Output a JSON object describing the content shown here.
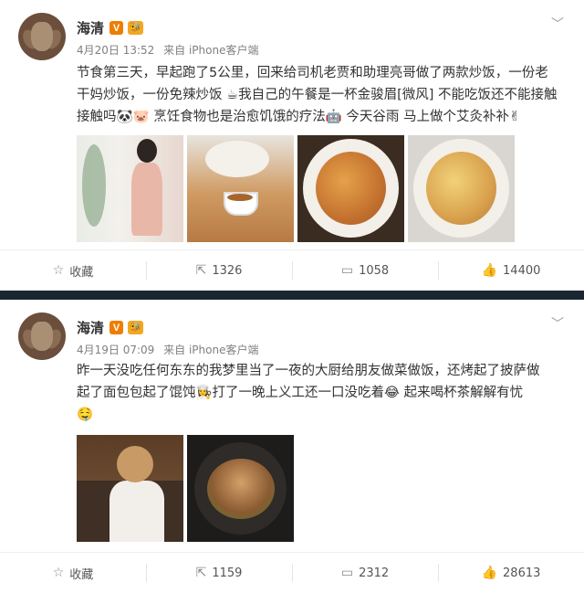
{
  "posts": [
    {
      "author": "海清",
      "verified_badge": "V",
      "vip_badge": "🐝",
      "date": "4月20日 13:52",
      "source": "来自 iPhone客户端",
      "text_lines": [
        "节食第三天，早起跑了5公里，回来给司机老贾和助理亮哥做了两款炒饭，一份老",
        "干妈炒饭，一份免辣炒饭 ☕我自己的午餐是一杯金骏眉[微风] 不能吃饭还不能接触",
        "接触吗🐼🐷 烹饪食物也是治愈饥饿的疗法🤖 今天谷雨 马上做个艾灸补补✌"
      ],
      "photos": [
        "woman-in-pink-dress-photo",
        "tea-cup-photo",
        "spicy-fried-rice-photo",
        "mild-fried-rice-photo"
      ],
      "actions": {
        "favorite": "收藏",
        "repost": "1326",
        "comment": "1058",
        "like": "14400"
      }
    },
    {
      "author": "海清",
      "verified_badge": "V",
      "vip_badge": "🐝",
      "date": "4月19日 07:09",
      "source": "来自 iPhone客户端",
      "text_lines": [
        "昨一天没吃任何东东的我梦里当了一夜的大厨给朋友做菜做饭，还烤起了披萨做",
        "起了面包包起了馄饨👩‍🍳打了一晚上义工还一口没吃着😂 起来喝杯茶解解有忧",
        "🤤"
      ],
      "photos": [
        "woman-in-kitchen-photo",
        "braised-dish-in-pot-photo"
      ],
      "actions": {
        "favorite": "收藏",
        "repost": "1159",
        "comment": "2312",
        "like": "28613"
      }
    }
  ],
  "icons": {
    "favorite": "star-icon",
    "repost": "repost-icon",
    "comment": "comment-icon",
    "like": "thumbs-up-icon",
    "menu": "chevron-down-icon"
  },
  "colors": {
    "separator": "#1b2633",
    "verified": "#ef7d00",
    "meta_text": "#808080"
  }
}
